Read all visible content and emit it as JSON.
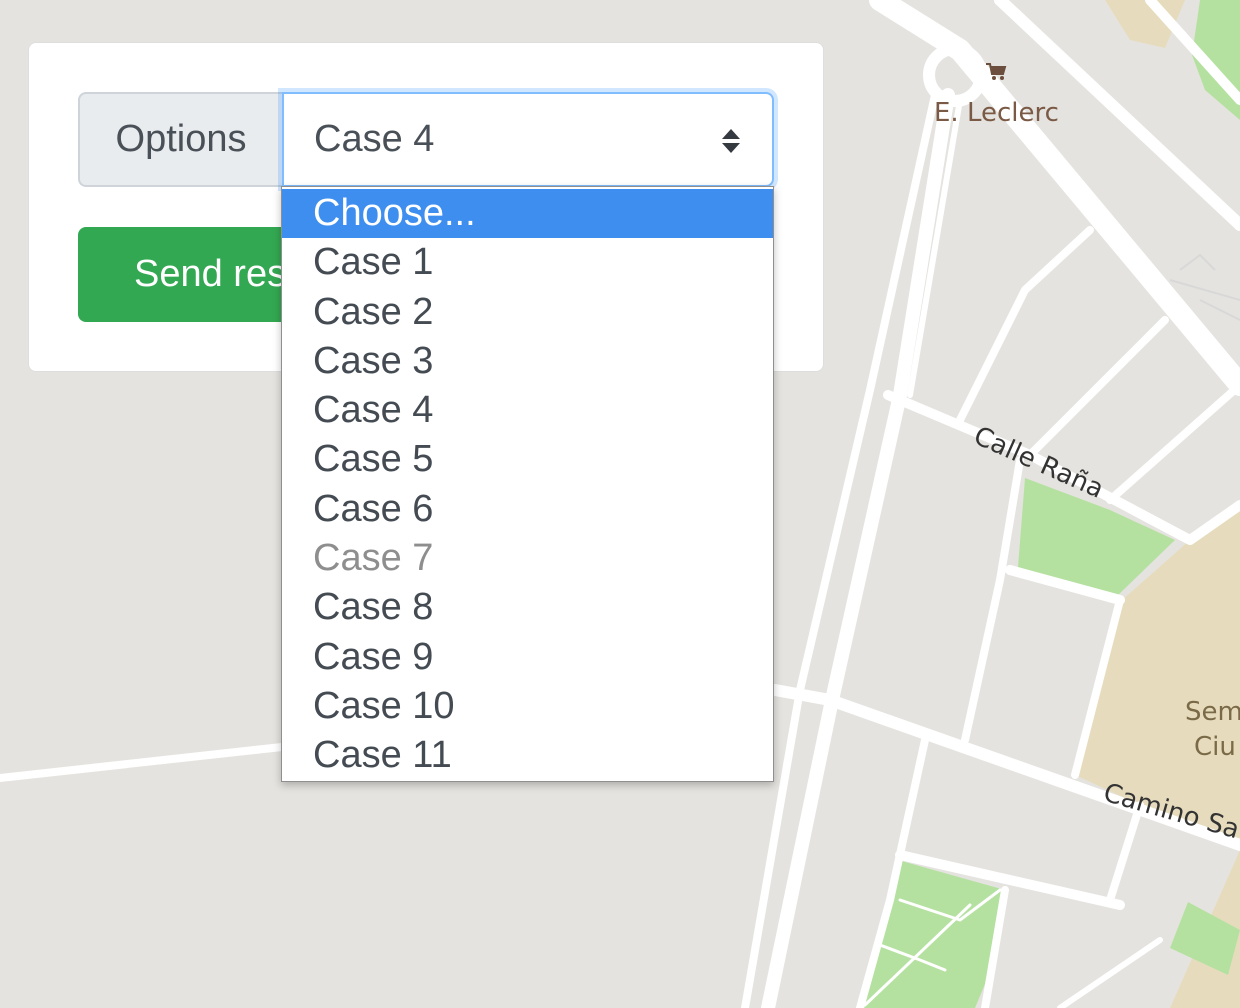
{
  "map": {
    "poi_name": "E. Leclerc",
    "streets": [
      "Calle Raña",
      "Camino Sa"
    ],
    "area_label_lines": [
      "Sem",
      "Ciu"
    ],
    "colors": {
      "background": "#e5e3df",
      "road": "#ffffff",
      "park": "#b5e1a0",
      "area": "#e6dcbd",
      "poi_text": "#7a5a45",
      "street_text": "#333333"
    }
  },
  "form": {
    "input_label": "Options",
    "select_value": "Case 4",
    "send_button_label": "Send res",
    "dropdown": {
      "options": [
        {
          "label": "Choose...",
          "state": "highlighted"
        },
        {
          "label": "Case 1",
          "state": "normal"
        },
        {
          "label": "Case 2",
          "state": "normal"
        },
        {
          "label": "Case 3",
          "state": "normal"
        },
        {
          "label": "Case 4",
          "state": "normal"
        },
        {
          "label": "Case 5",
          "state": "normal"
        },
        {
          "label": "Case 6",
          "state": "normal"
        },
        {
          "label": "Case 7",
          "state": "disabled"
        },
        {
          "label": "Case 8",
          "state": "normal"
        },
        {
          "label": "Case 9",
          "state": "normal"
        },
        {
          "label": "Case 10",
          "state": "normal"
        },
        {
          "label": "Case 11",
          "state": "normal"
        }
      ]
    },
    "colors": {
      "send_button": "#33a852",
      "highlight": "#3e8ef0",
      "focus_border": "#80bdff"
    }
  }
}
